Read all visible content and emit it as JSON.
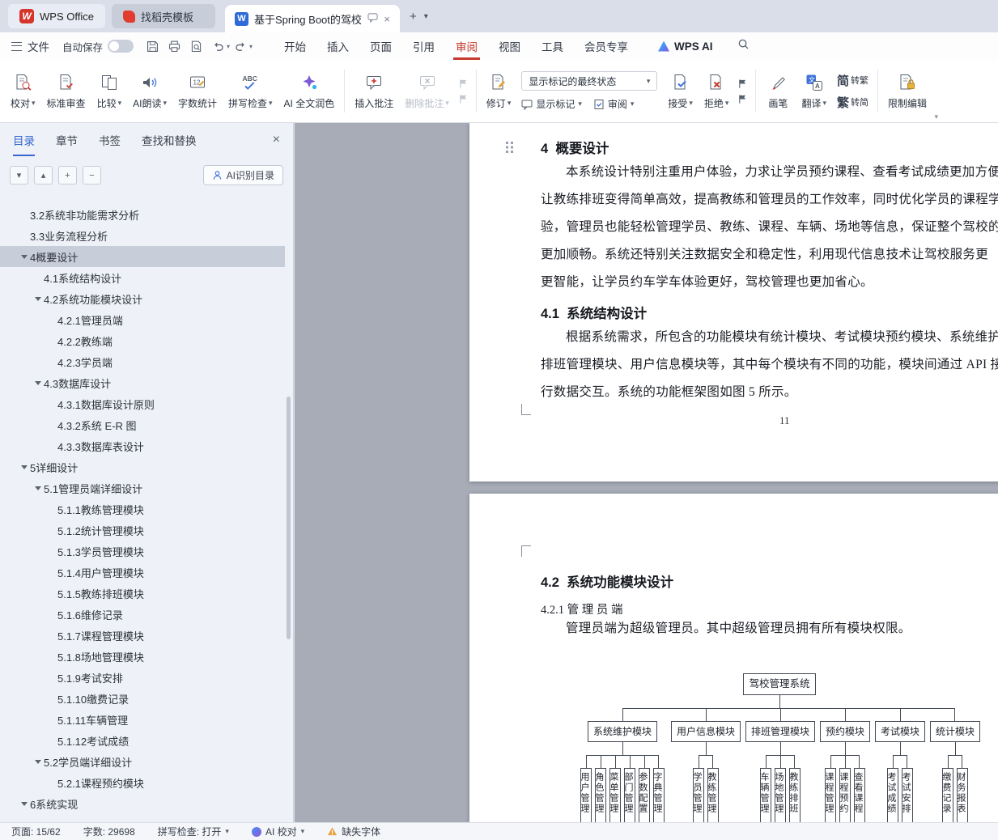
{
  "icons": {
    "wps_logo": "W",
    "doc_icon": "W",
    "chevron_down": "▾",
    "close": "×",
    "plus": "+",
    "caret_up": "▴",
    "caret_down": "▾",
    "minus": "−"
  },
  "tab_bar": {
    "app_tab": "WPS Office",
    "template_tab": "找稻壳模板",
    "doc_title": "基于Spring Boot的驾校管理"
  },
  "menu_bar": {
    "file": "文件",
    "autosave_label": "自动保存",
    "tabs": [
      {
        "label": "开始"
      },
      {
        "label": "插入"
      },
      {
        "label": "页面"
      },
      {
        "label": "引用"
      },
      {
        "label": "审阅",
        "active": true
      },
      {
        "label": "视图"
      },
      {
        "label": "工具"
      },
      {
        "label": "会员专享"
      }
    ],
    "wps_ai": "WPS AI"
  },
  "ribbon": {
    "proofread": "校对",
    "standard_review": "标准审查",
    "compare": "比较",
    "ai_read": "AI朗读",
    "word_count": "字数统计",
    "spell_check": "拼写检查",
    "ai_polish": "AI 全文润色",
    "insert_comment": "插入批注",
    "delete_comment": "删除批注",
    "track_changes": "修订",
    "markup_state": "显示标记的最终状态",
    "show_markup": "显示标记",
    "review": "审阅",
    "accept": "接受",
    "reject": "拒绝",
    "brush": "画笔",
    "translate": "翻译",
    "s2t_big": "简",
    "s2t_small": "转繁",
    "t2s_big": "繁",
    "t2s_small": "转简",
    "restrict_edit": "限制编辑"
  },
  "sidebar": {
    "tabs": [
      {
        "label": "目录",
        "active": true
      },
      {
        "label": "章节"
      },
      {
        "label": "书签"
      },
      {
        "label": "查找和替换"
      }
    ],
    "ai_button": "AI识别目录",
    "toc": [
      {
        "label": "3.2系统非功能需求分析",
        "level": 1
      },
      {
        "label": "3.3业务流程分析",
        "level": 1
      },
      {
        "label": "4概要设计",
        "level": 1,
        "caret": true,
        "selected": true
      },
      {
        "label": "4.1系统结构设计",
        "level": 2
      },
      {
        "label": "4.2系统功能模块设计",
        "level": 2,
        "caret": true
      },
      {
        "label": "4.2.1管理员端",
        "level": 3
      },
      {
        "label": "4.2.2教练端",
        "level": 3
      },
      {
        "label": "4.2.3学员端",
        "level": 3
      },
      {
        "label": "4.3数据库设计",
        "level": 2,
        "caret": true
      },
      {
        "label": "4.3.1数据库设计原则",
        "level": 3
      },
      {
        "label": "4.3.2系统 E-R 图",
        "level": 3
      },
      {
        "label": "4.3.3数据库表设计",
        "level": 3
      },
      {
        "label": "5详细设计",
        "level": 1,
        "caret": true
      },
      {
        "label": "5.1管理员端详细设计",
        "level": 2,
        "caret": true
      },
      {
        "label": "5.1.1教练管理模块",
        "level": 3
      },
      {
        "label": "5.1.2统计管理模块",
        "level": 3
      },
      {
        "label": "5.1.3学员管理模块",
        "level": 3
      },
      {
        "label": "5.1.4用户管理模块",
        "level": 3
      },
      {
        "label": "5.1.5教练排班模块",
        "level": 3
      },
      {
        "label": "5.1.6维修记录",
        "level": 3
      },
      {
        "label": "5.1.7课程管理模块",
        "level": 3
      },
      {
        "label": "5.1.8场地管理模块",
        "level": 3
      },
      {
        "label": "5.1.9考试安排",
        "level": 3
      },
      {
        "label": "5.1.10缴费记录",
        "level": 3
      },
      {
        "label": "5.1.11车辆管理",
        "level": 3
      },
      {
        "label": "5.1.12考试成绩",
        "level": 3
      },
      {
        "label": "5.2学员端详细设计",
        "level": 2,
        "caret": true
      },
      {
        "label": "5.2.1课程预约模块",
        "level": 3
      },
      {
        "label": "6系统实现",
        "level": 1,
        "caret": true
      }
    ]
  },
  "document": {
    "page1": {
      "heading": "4  概要设计",
      "para1": [
        "本系统设计特别注重用户体验，力求让学员预约课程、查看考试成绩更加方便",
        "让教练排班变得简单高效，提高教练和管理员的工作效率，同时优化学员的课程学",
        "验，管理员也能轻松管理学员、教练、课程、车辆、场地等信息，保证整个驾校的",
        "更加顺畅。系统还特别关注数据安全和稳定性，利用现代信息技术让驾校服务更",
        "更智能，让学员约车学车体验更好，驾校管理也更加省心。"
      ],
      "heading2": "4.1  系统结构设计",
      "para2": [
        "根据系统需求，所包含的功能模块有统计模块、考试模块预约模块、系统维护",
        "排班管理模块、用户信息模块等，其中每个模块有不同的功能，模块间通过 API 接",
        "行数据交互。系统的功能框架图如图 5 所示。"
      ],
      "page_number": "11"
    },
    "page2": {
      "heading": "4.2  系统功能模块设计",
      "subheading": "4.2.1 管 理 员 端",
      "para": "管理员端为超级管理员。其中超级管理员拥有所有模块权限。",
      "diagram": {
        "root": "驾校管理系统",
        "modules": [
          {
            "label": "系统维护模块",
            "children": [
              "用户管理",
              "角色管理",
              "菜单管理",
              "部门管理",
              "参数配置",
              "字典管理"
            ]
          },
          {
            "label": "用户信息模块",
            "children": [
              "学员管理",
              "教练管理"
            ]
          },
          {
            "label": "排班管理模块",
            "children": [
              "车辆管理",
              "场地管理",
              "教练排班"
            ]
          },
          {
            "label": "预约模块",
            "children": [
              "课程管理",
              "课程预约",
              "查看课程"
            ]
          },
          {
            "label": "考试模块",
            "children": [
              "考试成绩",
              "考试安排"
            ]
          },
          {
            "label": "统计模块",
            "children": [
              "缴费记录",
              "财务报表"
            ]
          }
        ]
      }
    }
  },
  "status_bar": {
    "page": "页面: 15/62",
    "words": "字数: 29698",
    "spellcheck": "拼写检查: 打开",
    "ai_proof": "AI 校对",
    "missing_font": "缺失字体"
  }
}
